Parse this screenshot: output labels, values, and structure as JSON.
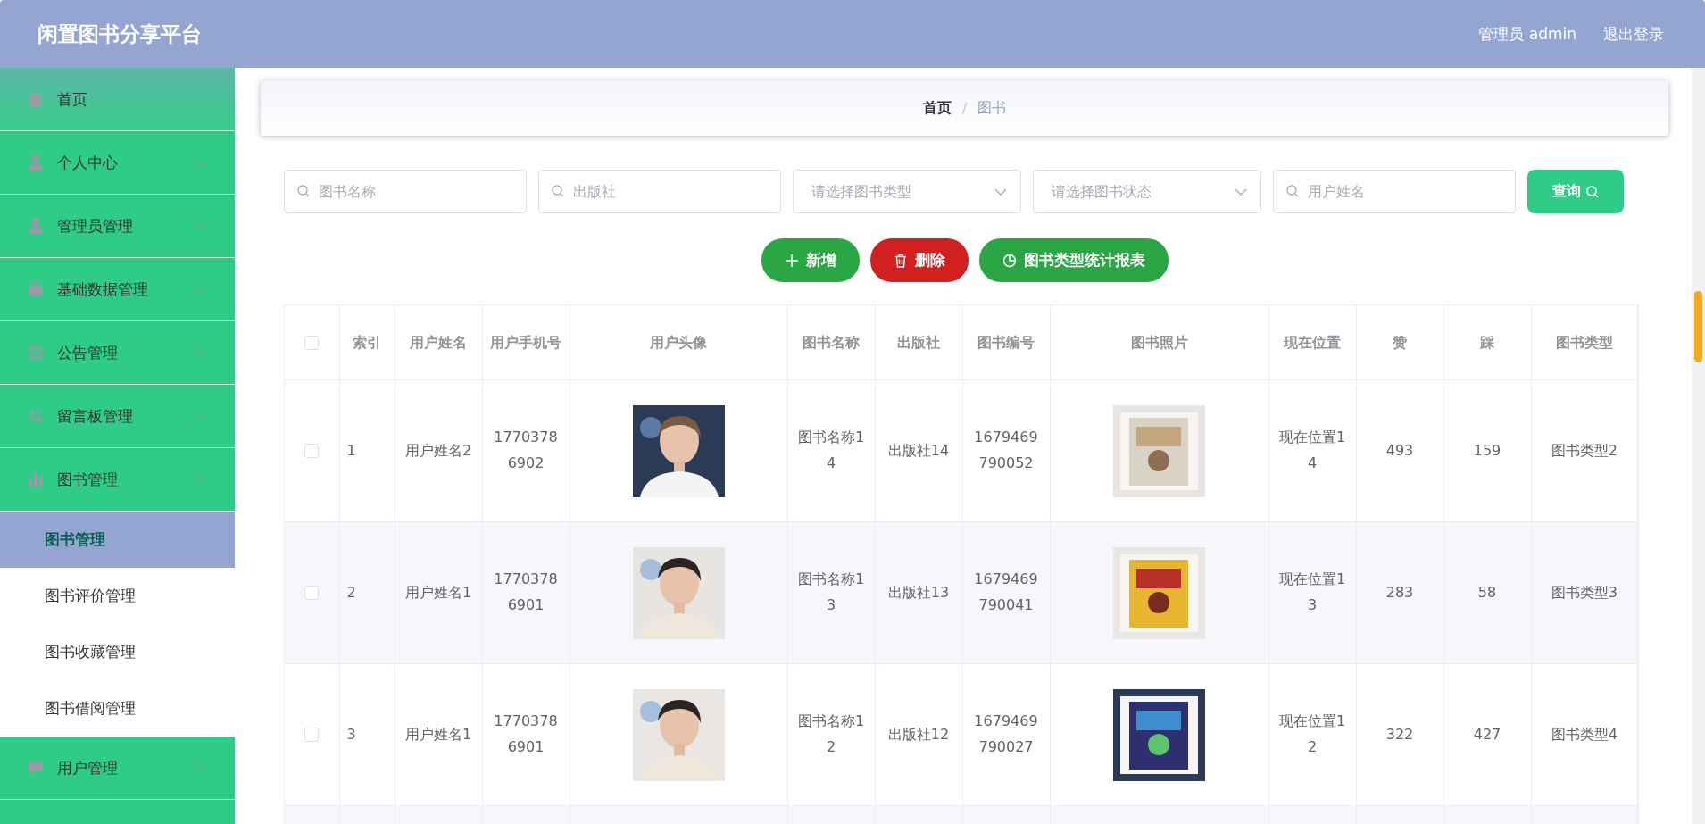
{
  "header": {
    "title": "闲置图书分享平台",
    "user": "管理员 admin",
    "logout": "退出登录"
  },
  "sidebar": {
    "items": [
      {
        "label": "首页",
        "kind": "link",
        "selected": true
      },
      {
        "label": "个人中心",
        "kind": "group",
        "selected": false,
        "expanded": false
      },
      {
        "label": "管理员管理",
        "kind": "group",
        "selected": false,
        "expanded": false
      },
      {
        "label": "基础数据管理",
        "kind": "group",
        "selected": false,
        "expanded": false
      },
      {
        "label": "公告管理",
        "kind": "group",
        "selected": false,
        "expanded": false
      },
      {
        "label": "留言板管理",
        "kind": "group",
        "selected": false,
        "expanded": false
      },
      {
        "label": "图书管理",
        "kind": "group",
        "selected": false,
        "expanded": true,
        "children": [
          {
            "label": "图书管理",
            "selected": true
          },
          {
            "label": "图书评价管理",
            "selected": false
          },
          {
            "label": "图书收藏管理",
            "selected": false
          },
          {
            "label": "图书借阅管理",
            "selected": false
          }
        ]
      },
      {
        "label": "用户管理",
        "kind": "group",
        "selected": false,
        "expanded": false
      }
    ]
  },
  "breadcrumb": [
    "首页",
    "图书"
  ],
  "breadcrumb_separator": "/",
  "filters": [
    {
      "kind": "search",
      "placeholder": "图书名称"
    },
    {
      "kind": "search",
      "placeholder": "出版社"
    },
    {
      "kind": "select",
      "placeholder": "请选择图书类型"
    },
    {
      "kind": "select",
      "placeholder": "请选择图书状态"
    },
    {
      "kind": "search",
      "placeholder": "用户姓名"
    }
  ],
  "query_button": "查询",
  "actions": [
    {
      "kind": "add",
      "label": "新增"
    },
    {
      "kind": "delete",
      "label": "删除"
    },
    {
      "kind": "chart",
      "label": "图书类型统计报表"
    }
  ],
  "table": {
    "select_all_checked": false,
    "columns": [
      "索引",
      "用户姓名",
      "用户手机号",
      "用户头像",
      "图书名称",
      "出版社",
      "图书编号",
      "图书照片",
      "现在位置",
      "赞",
      "踩",
      "图书类型"
    ],
    "rows": [
      {
        "checked": false,
        "cells": [
          "1",
          "用户姓名2",
          "17703786902",
          {
            "kind": "picture"
          },
          "图书名称14",
          "出版社14",
          "1679469790052",
          {
            "kind": "picture"
          },
          "现在位置14",
          "493",
          "159",
          "图书类型2"
        ]
      },
      {
        "checked": false,
        "cells": [
          "2",
          "用户姓名1",
          "17703786901",
          {
            "kind": "picture"
          },
          "图书名称13",
          "出版社13",
          "1679469790041",
          {
            "kind": "picture"
          },
          "现在位置13",
          "283",
          "58",
          "图书类型3"
        ]
      },
      {
        "checked": false,
        "cells": [
          "3",
          "用户姓名1",
          "17703786901",
          {
            "kind": "picture"
          },
          "图书名称12",
          "出版社12",
          "1679469790027",
          {
            "kind": "picture"
          },
          "现在位置12",
          "322",
          "427",
          "图书类型4"
        ]
      }
    ]
  }
}
